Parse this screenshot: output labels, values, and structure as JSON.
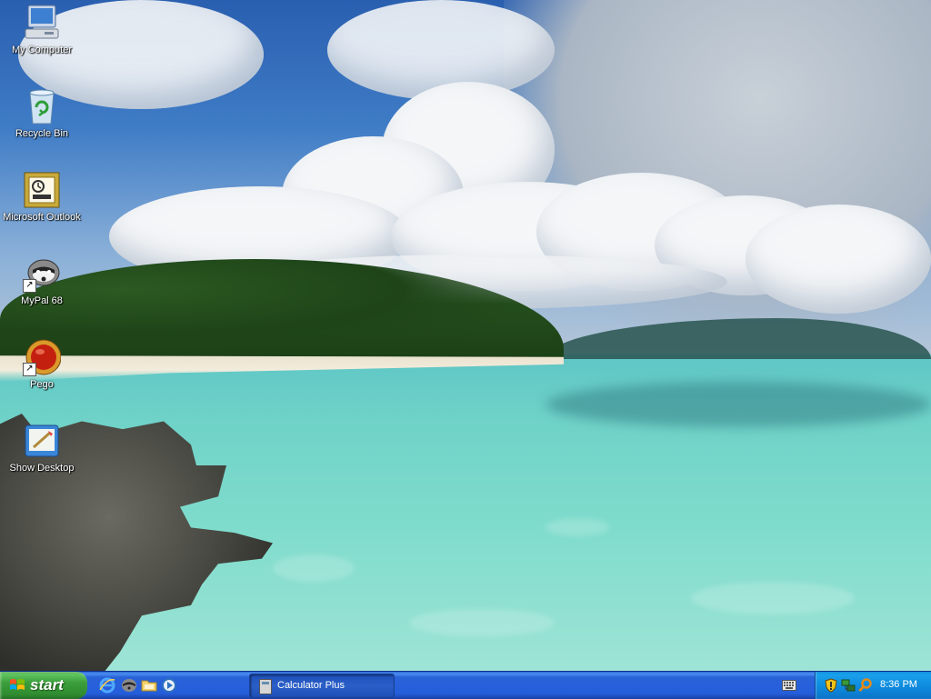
{
  "desktop": {
    "icons": [
      {
        "label": "My Computer",
        "icon": "my-computer-icon"
      },
      {
        "label": "Recycle Bin",
        "icon": "recycle-bin-icon"
      },
      {
        "label": "Microsoft Outlook",
        "icon": "outlook-icon"
      },
      {
        "label": "MyPal 68",
        "icon": "mypal-icon"
      },
      {
        "label": "Pego",
        "icon": "pego-icon"
      },
      {
        "label": "Show Desktop",
        "icon": "show-desktop-icon"
      }
    ]
  },
  "taskbar": {
    "start_label": "start",
    "quick_launch": [
      "internet-explorer-icon",
      "mypal-icon",
      "folder-icon",
      "media-player-icon"
    ],
    "tasks": [
      {
        "label": "Calculator Plus",
        "icon": "calculator-icon"
      }
    ],
    "tray": {
      "icons": [
        "security-shield-icon",
        "network-icon",
        "search-icon"
      ],
      "clock": "8:36 PM"
    }
  },
  "colors": {
    "taskbar_blue": "#245edb",
    "start_green": "#3b9e3b",
    "tray_blue": "#0f8de0"
  }
}
